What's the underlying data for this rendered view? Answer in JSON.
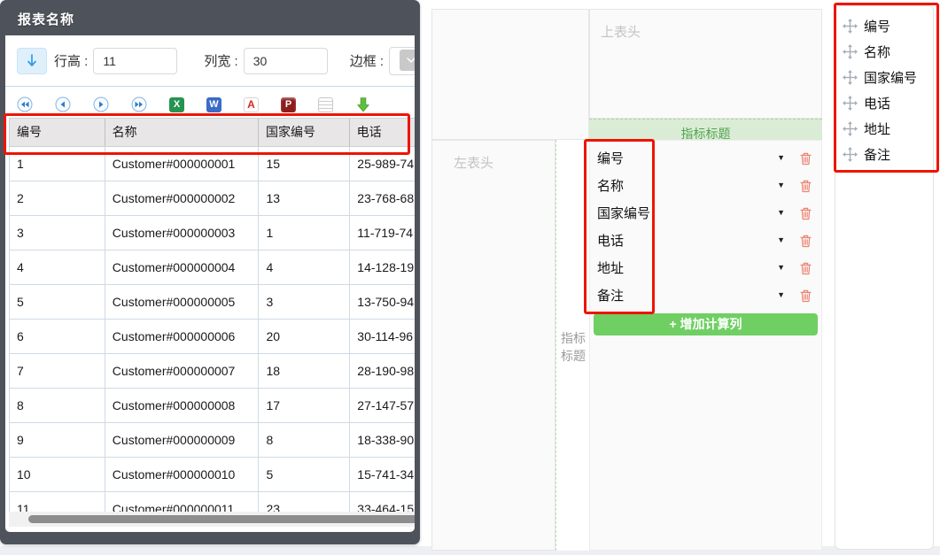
{
  "window": {
    "title": "报表名称",
    "toolbar": {
      "row_height_label": "行高 :",
      "row_height_value": "11",
      "col_width_label": "列宽 :",
      "col_width_value": "30",
      "border_label": "边框 :"
    },
    "table": {
      "columns": [
        "编号",
        "名称",
        "国家编号",
        "电话"
      ],
      "rows": [
        [
          "1",
          "Customer#000000001",
          "15",
          "25-989-74"
        ],
        [
          "2",
          "Customer#000000002",
          "13",
          "23-768-68"
        ],
        [
          "3",
          "Customer#000000003",
          "1",
          "11-719-74"
        ],
        [
          "4",
          "Customer#000000004",
          "4",
          "14-128-19"
        ],
        [
          "5",
          "Customer#000000005",
          "3",
          "13-750-94"
        ],
        [
          "6",
          "Customer#000000006",
          "20",
          "30-114-96"
        ],
        [
          "7",
          "Customer#000000007",
          "18",
          "28-190-98"
        ],
        [
          "8",
          "Customer#000000008",
          "17",
          "27-147-57"
        ],
        [
          "9",
          "Customer#000000009",
          "8",
          "18-338-90"
        ],
        [
          "10",
          "Customer#000000010",
          "5",
          "15-741-34"
        ],
        [
          "11",
          "Customer#000000011",
          "23",
          "33-464-15"
        ]
      ]
    }
  },
  "designer": {
    "top_header_label": "上表头",
    "left_header_label": "左表头",
    "indicator_title_bar": "指标标题",
    "indicator_side_label": "指标标题",
    "fields": [
      "编号",
      "名称",
      "国家编号",
      "电话",
      "地址",
      "备注"
    ],
    "add_calc_column_button": "+ 增加计算列"
  },
  "palette": {
    "items": [
      "编号",
      "名称",
      "国家编号",
      "电话",
      "地址",
      "备注"
    ]
  },
  "icons": {
    "first_page": "first-page-icon",
    "prev_page": "prev-page-icon",
    "next_page": "next-page-icon",
    "last_page": "last-page-icon",
    "excel_label": "X",
    "word_label": "W",
    "pdf_label": "A",
    "print_label": "P"
  },
  "colors": {
    "highlight_red": "#ee1400",
    "green_button": "#6fcf63",
    "indicator_green_bg": "#daecd6",
    "indicator_green_text": "#53a550",
    "titlebar_gray": "#4e535b",
    "header_row_bg": "#e8e6e7",
    "table_border": "#cfdae5"
  }
}
